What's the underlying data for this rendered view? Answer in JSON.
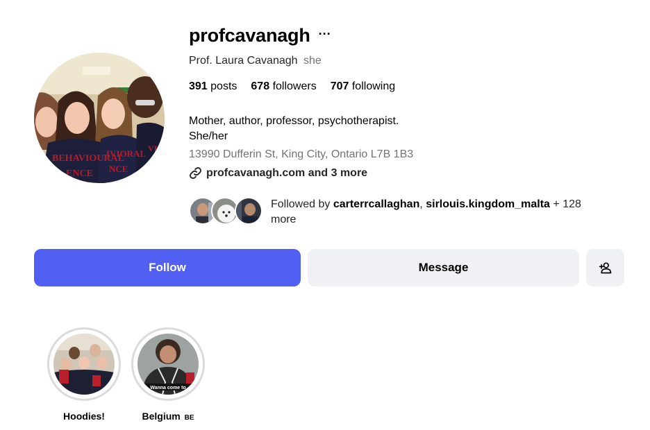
{
  "profile": {
    "username": "profcavanagh",
    "more_icon": "···",
    "full_name": "Prof. Laura Cavanagh",
    "pronoun": "she",
    "posts_count": "391",
    "posts_label": "posts",
    "followers_count": "678",
    "followers_label": "followers",
    "following_count": "707",
    "following_label": "following",
    "bio_line1": "Mother, author, professor, psychotherapist.",
    "bio_line2": "She/her",
    "address": "13990 Dufferin St, King City, Ontario L7B 1B3",
    "link_text": "profcavanagh.com and 3 more",
    "link_icon": "link-icon"
  },
  "followed_by": {
    "prefix": "Followed by ",
    "user1": "carterrcallaghan",
    "separator": ", ",
    "user2": "sirlouis.kingdom_malta",
    "suffix": " + 128 more"
  },
  "actions": {
    "follow_label": "Follow",
    "message_label": "Message",
    "add_user_icon": "add-user-icon"
  },
  "highlights": [
    {
      "label": "Hoodies!",
      "badge": ""
    },
    {
      "label": "Belgium",
      "badge": "BE",
      "overlay_text": "Wanna come to"
    }
  ],
  "colors": {
    "follow_button": "#5160f3",
    "secondary_button": "#f0f1f4",
    "muted_text": "#737373"
  }
}
